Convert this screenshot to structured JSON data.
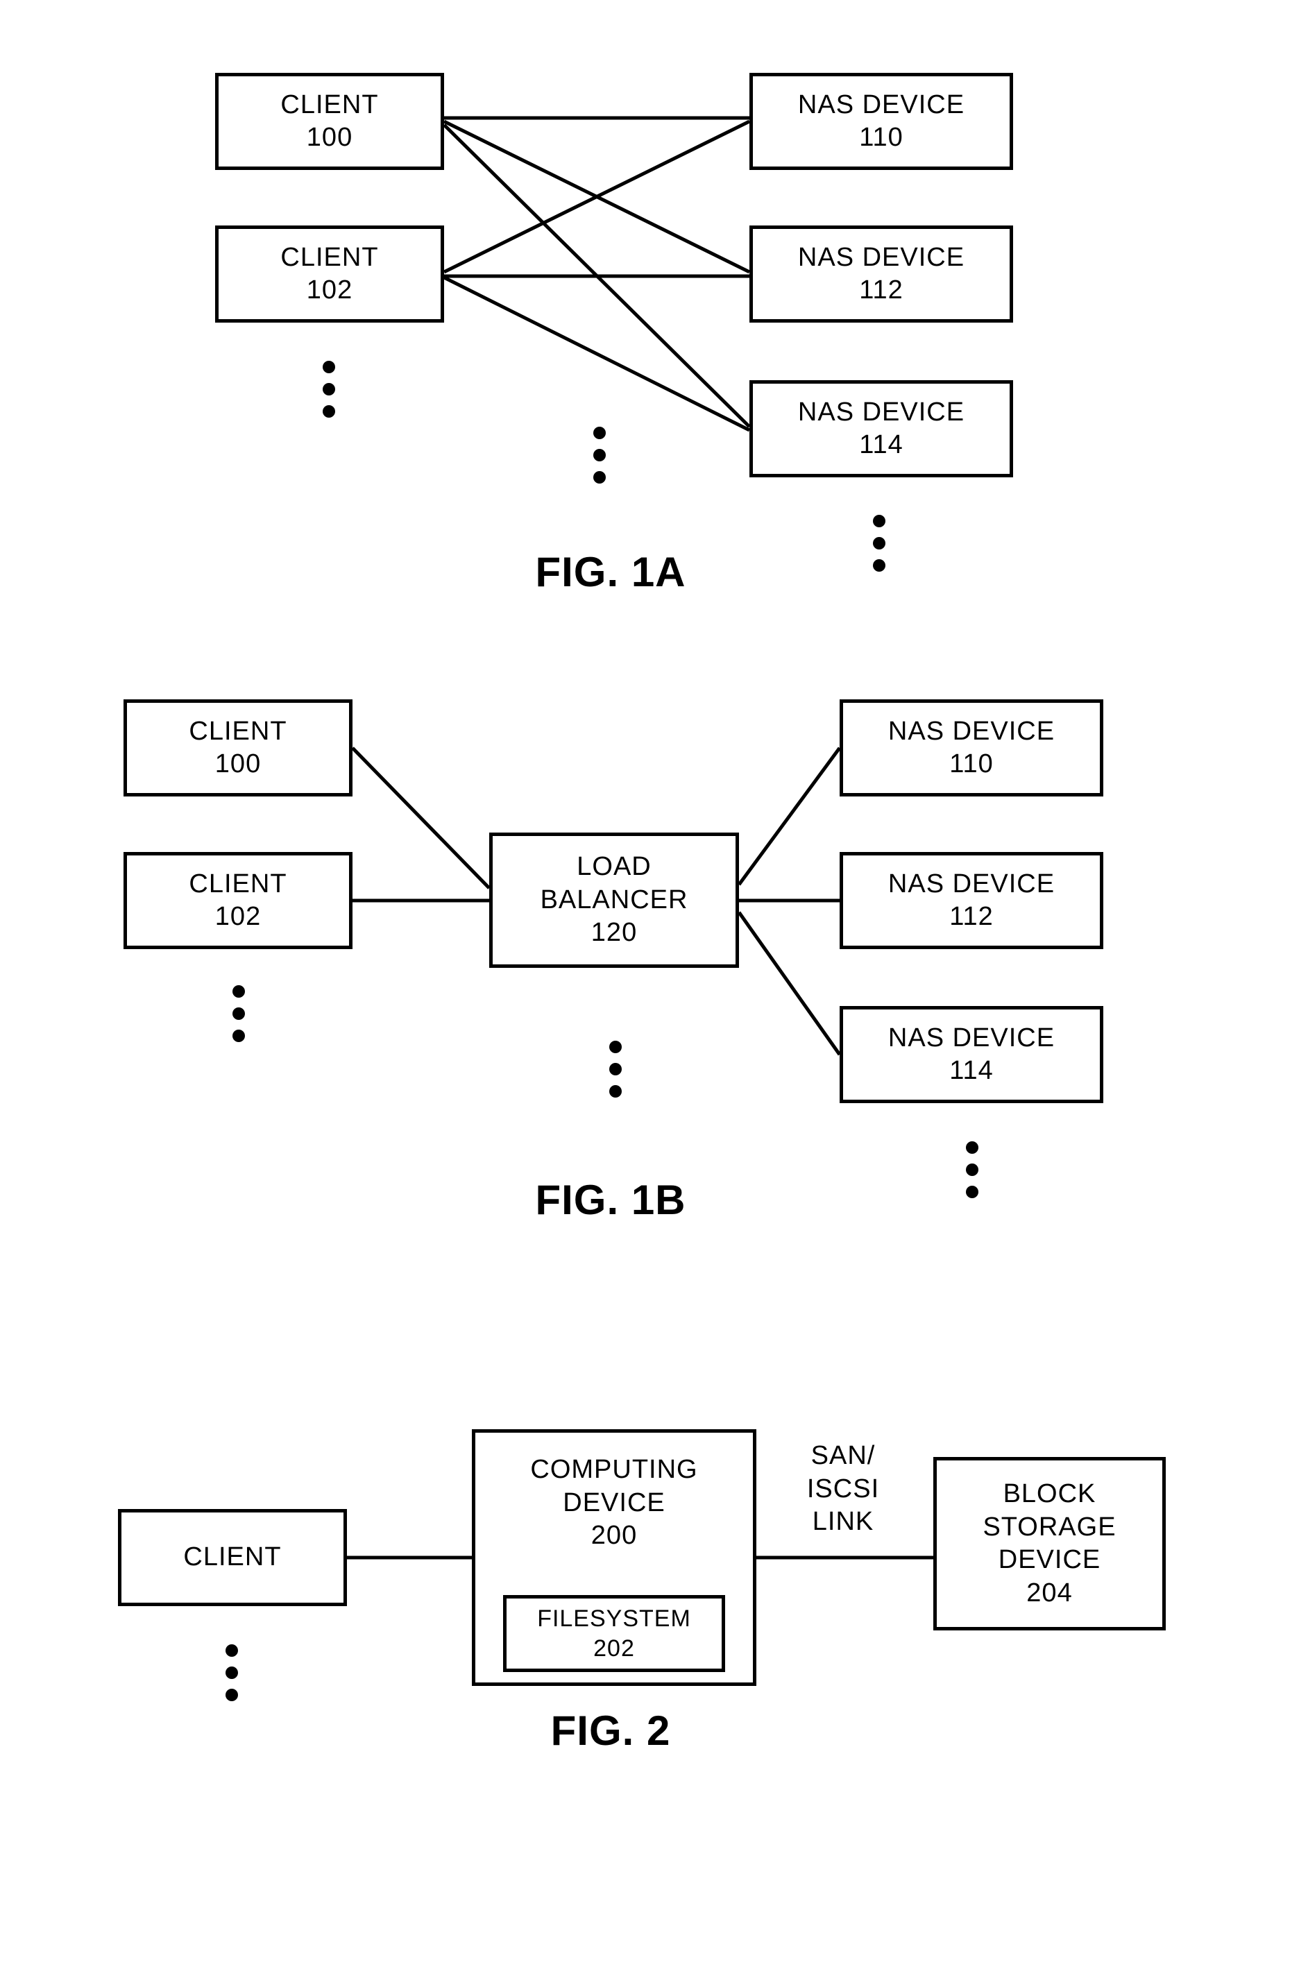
{
  "fig1a": {
    "caption": "FIG. 1A",
    "client1": {
      "label": "CLIENT",
      "num": "100"
    },
    "client2": {
      "label": "CLIENT",
      "num": "102"
    },
    "nas1": {
      "label": "NAS DEVICE",
      "num": "110"
    },
    "nas2": {
      "label": "NAS DEVICE",
      "num": "112"
    },
    "nas3": {
      "label": "NAS DEVICE",
      "num": "114"
    }
  },
  "fig1b": {
    "caption": "FIG. 1B",
    "client1": {
      "label": "CLIENT",
      "num": "100"
    },
    "client2": {
      "label": "CLIENT",
      "num": "102"
    },
    "lb": {
      "label1": "LOAD",
      "label2": "BALANCER",
      "num": "120"
    },
    "nas1": {
      "label": "NAS DEVICE",
      "num": "110"
    },
    "nas2": {
      "label": "NAS DEVICE",
      "num": "112"
    },
    "nas3": {
      "label": "NAS DEVICE",
      "num": "114"
    }
  },
  "fig2": {
    "caption": "FIG. 2",
    "client": {
      "label": "CLIENT"
    },
    "compute": {
      "label1": "COMPUTING",
      "label2": "DEVICE",
      "num": "200"
    },
    "fs": {
      "label": "FILESYSTEM",
      "num": "202"
    },
    "link": {
      "label1": "SAN/",
      "label2": "ISCSI",
      "label3": "LINK"
    },
    "storage": {
      "label1": "BLOCK",
      "label2": "STORAGE",
      "label3": "DEVICE",
      "num": "204"
    }
  }
}
